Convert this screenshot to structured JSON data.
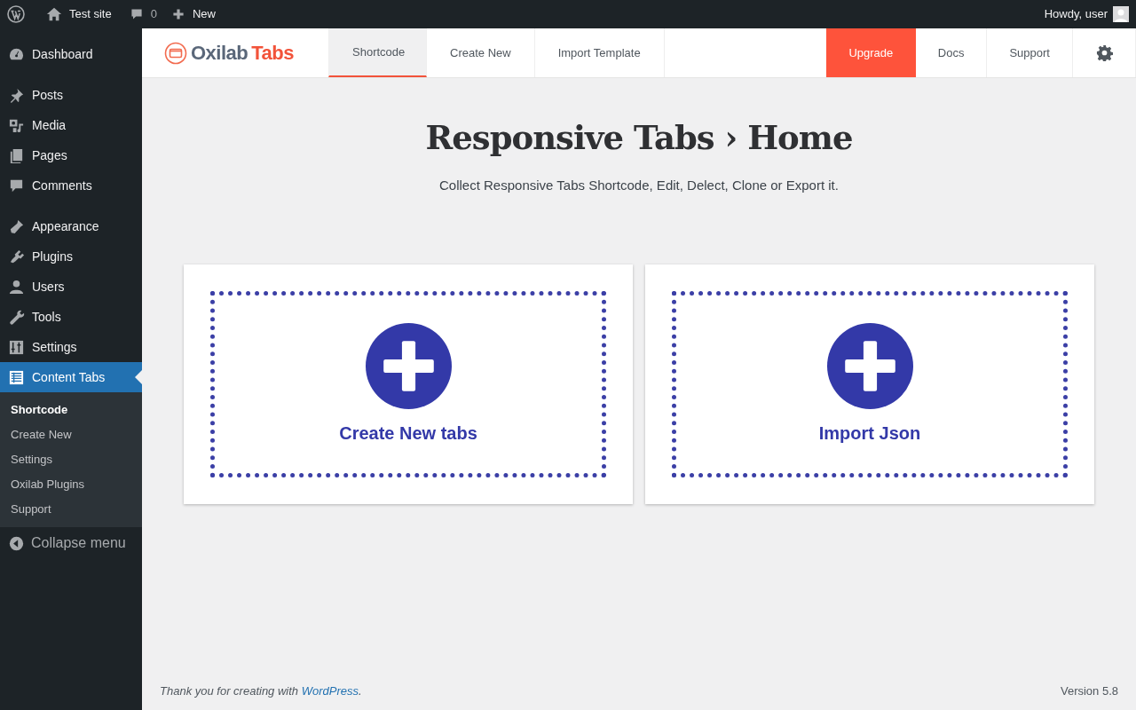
{
  "admin_bar": {
    "site_name": "Test site",
    "comments_count": "0",
    "new_label": "New",
    "greeting": "Howdy, user"
  },
  "sidebar": {
    "groups": [
      [
        {
          "label": "Dashboard",
          "selected": false
        }
      ],
      [
        {
          "label": "Posts",
          "selected": false
        },
        {
          "label": "Media",
          "selected": false
        },
        {
          "label": "Pages",
          "selected": false
        },
        {
          "label": "Comments",
          "selected": false
        }
      ],
      [
        {
          "label": "Appearance",
          "selected": false
        },
        {
          "label": "Plugins",
          "selected": false
        },
        {
          "label": "Users",
          "selected": false
        },
        {
          "label": "Tools",
          "selected": false
        },
        {
          "label": "Settings",
          "selected": false
        },
        {
          "label": "Content Tabs",
          "selected": true
        }
      ]
    ],
    "submenu": [
      {
        "label": "Shortcode",
        "selected": true
      },
      {
        "label": "Create New",
        "selected": false
      },
      {
        "label": "Settings",
        "selected": false
      },
      {
        "label": "Oxilab Plugins",
        "selected": false
      },
      {
        "label": "Support",
        "selected": false
      }
    ],
    "collapse_label": "Collapse menu"
  },
  "header": {
    "logo_word_1": "Oxilab",
    "logo_word_2": "Tabs",
    "tabs": [
      {
        "label": "Shortcode",
        "selected": true
      },
      {
        "label": "Create New",
        "selected": false
      },
      {
        "label": "Import Template",
        "selected": false
      }
    ],
    "actions": [
      {
        "label": "Upgrade",
        "kind": "upgrade"
      },
      {
        "label": "Docs",
        "kind": "link"
      },
      {
        "label": "Support",
        "kind": "link"
      }
    ]
  },
  "main": {
    "title": "Responsive Tabs › Home",
    "subtitle": "Collect Responsive Tabs Shortcode, Edit, Delect, Clone or Export it.",
    "cards": [
      {
        "label": "Create New tabs"
      },
      {
        "label": "Import Json"
      }
    ]
  },
  "footer": {
    "text_before": "Thank you for creating with ",
    "link": "WordPress",
    "text_after": ".",
    "version": "Version 5.8"
  }
}
